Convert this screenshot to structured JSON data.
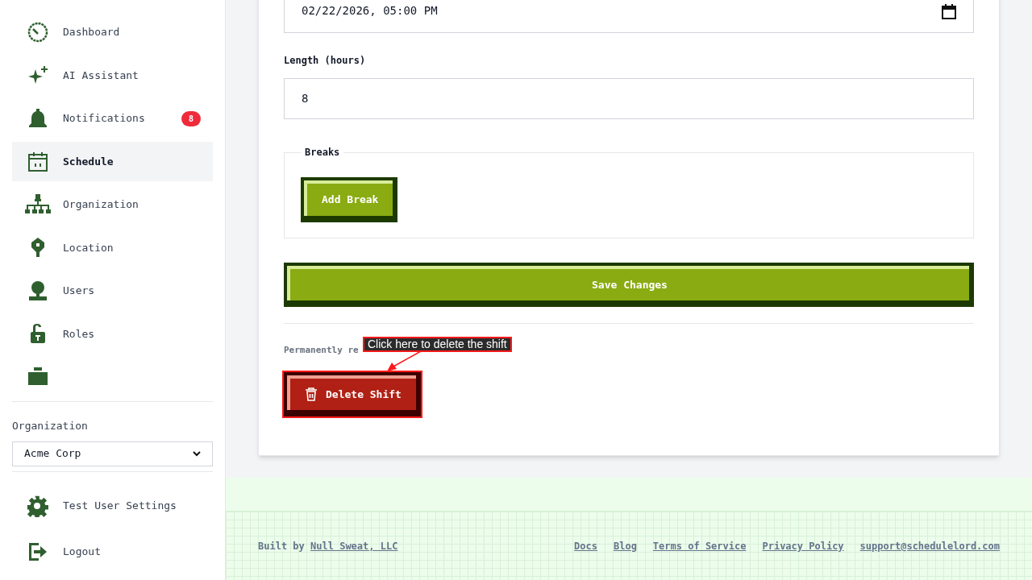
{
  "sidebar": {
    "items": [
      {
        "kind": "dashboard",
        "label": "Dashboard",
        "selected": false
      },
      {
        "kind": "sparkle",
        "label": "AI Assistant",
        "selected": false
      },
      {
        "kind": "bell",
        "label": "Notifications",
        "selected": false,
        "badge": "8"
      },
      {
        "kind": "calendar",
        "label": "Schedule",
        "selected": true
      },
      {
        "kind": "org",
        "label": "Organization",
        "selected": false
      },
      {
        "kind": "pin",
        "label": "Location",
        "selected": false
      },
      {
        "kind": "user",
        "label": "Users",
        "selected": false
      },
      {
        "kind": "lock",
        "label": "Roles",
        "selected": false
      },
      {
        "kind": "briefcase",
        "selected": false
      }
    ],
    "organization": {
      "label": "Organization",
      "value": "Acme Corp"
    },
    "bottom_items": [
      {
        "kind": "gear",
        "label": "Test User Settings"
      },
      {
        "kind": "logout",
        "label": "Logout"
      }
    ]
  },
  "form": {
    "end_field": {
      "value": "02/22/2026, 05:00 PM"
    },
    "length": {
      "label": "Length (hours)",
      "value": "8"
    },
    "breaks": {
      "legend": "Breaks",
      "button": "Add Break"
    },
    "save_button": "Save Changes",
    "danger": {
      "description": "Permanently re",
      "button": "Delete Shift"
    }
  },
  "annotation": {
    "text": "Click here to delete the shift"
  },
  "footer": {
    "built_by": "Built by",
    "company": "Null Sweat, LLC",
    "links": [
      "Docs",
      "Blog",
      "Terms of Service",
      "Privacy Policy",
      "support@schedulelord.com"
    ]
  }
}
